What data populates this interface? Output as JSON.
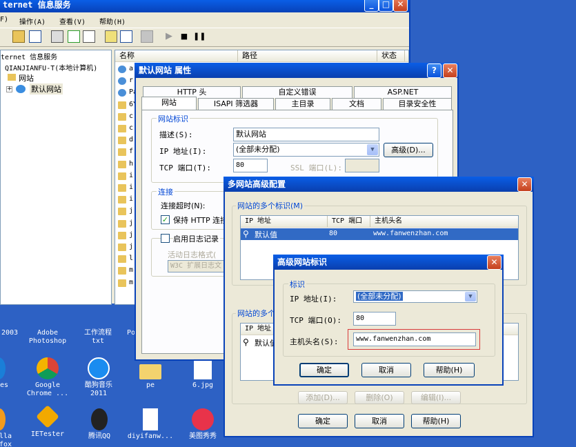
{
  "desktop": {
    "icons": [
      {
        "label": "2003",
        "label2": ""
      },
      {
        "label": "Adobe",
        "label2": "Photoshop"
      },
      {
        "label": "工作流程",
        "label2": "txt"
      },
      {
        "label": "Po",
        "label2": ""
      },
      {
        "label": "es",
        "label2": ""
      },
      {
        "label": "Google",
        "label2": "Chrome ..."
      },
      {
        "label": "酷狗音乐",
        "label2": "2011"
      },
      {
        "label": "pe",
        "label2": ""
      },
      {
        "label": "6.jpg",
        "label2": ""
      },
      {
        "label": "lla",
        "label2": "fox"
      },
      {
        "label": "IETester",
        "label2": ""
      },
      {
        "label": "腾讯QQ",
        "label2": ""
      },
      {
        "label": "diyifanw...",
        "label2": ""
      },
      {
        "label": "美图秀秀",
        "label2": ""
      }
    ]
  },
  "iis": {
    "title": "ternet 信息服务",
    "menu": [
      "F)",
      "操作(A)",
      "查看(V)",
      "帮助(H)"
    ],
    "tree": [
      "ternet 信息服务",
      "QIANJIANFU-T(本地计算机)",
      "网站",
      "默认网站"
    ],
    "list_headers": [
      "名称",
      "路径",
      "状态"
    ],
    "list_items": [
      "a",
      "r",
      "Pa",
      "6Y",
      "c",
      "c",
      "d",
      "f",
      "h",
      "i",
      "i",
      "i",
      "j",
      "j",
      "j",
      "j",
      "l",
      "m",
      "m"
    ]
  },
  "props": {
    "title": "默认网站 属性",
    "tabs_row1": [
      "HTTP 头",
      "自定义错误",
      "ASP.NET"
    ],
    "tabs_row2": [
      "网站",
      "ISAPI 筛选器",
      "主目录",
      "文档",
      "目录安全性"
    ],
    "group_identity": "网站标识",
    "desc_label": "描述(S):",
    "desc_value": "默认网站",
    "ip_label": "IP 地址(I):",
    "ip_value": "(全部未分配)",
    "advanced_btn": "高级(D)...",
    "tcp_label": "TCP 端口(T):",
    "tcp_value": "80",
    "ssl_label": "SSL 端口(L):",
    "ssl_value": "",
    "group_conn": "连接",
    "timeout_label": "连接超时(N):",
    "keepalive_label": "保持 HTTP 连接",
    "logging_label": "启用日志记录",
    "logformat_label": "活动日志格式(",
    "logformat_value": "W3C 扩展日志文"
  },
  "multi": {
    "title": "多网站高级配置",
    "group1": "网站的多个标识(M)",
    "headers": [
      "IP 地址",
      "TCP 端口",
      "主机头名"
    ],
    "row": {
      "ip": "默认值",
      "port": "80",
      "host": "www.fanwenzhan.com"
    },
    "group2": "网站的多个",
    "row2_ip": "默认值",
    "row2_header": "IP 地址",
    "add_btn": "添加(D)...",
    "remove_btn": "删除(O)",
    "edit_btn": "编辑(I)...",
    "ok_btn": "确定",
    "cancel_btn": "取消",
    "help_btn": "帮助(H)"
  },
  "adv": {
    "title": "高级网站标识",
    "group": "标识",
    "ip_label": "IP 地址(I):",
    "ip_value": "(全部未分配)",
    "tcp_label": "TCP 端口(O):",
    "tcp_value": "80",
    "host_label": "主机头名(S):",
    "host_value": "www.fanwenzhan.com",
    "ok_btn": "确定",
    "cancel_btn": "取消",
    "help_btn": "帮助(H)"
  }
}
